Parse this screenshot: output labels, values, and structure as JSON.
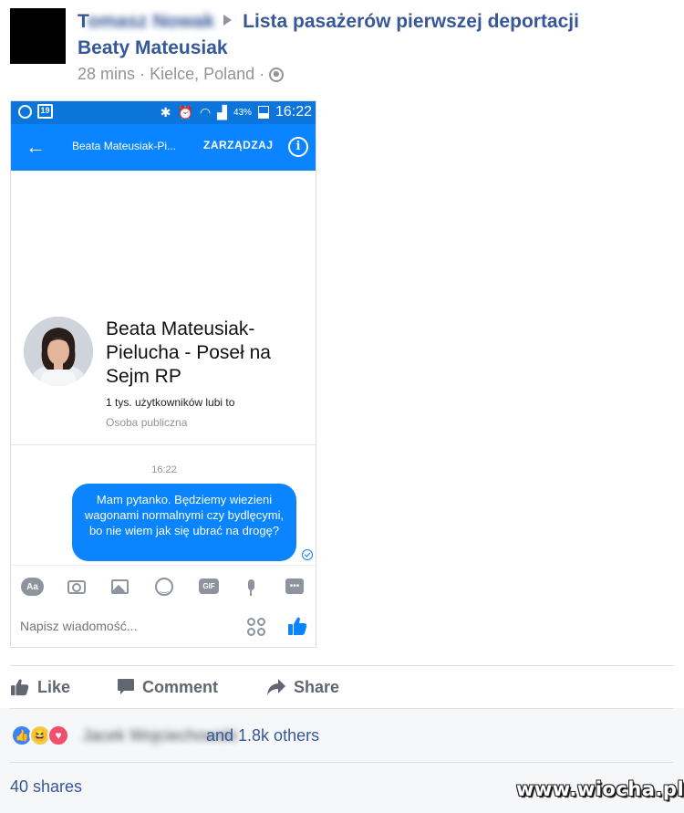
{
  "post": {
    "author_visible": "T",
    "author_blurred": "omasz Nowak",
    "group_title": "Lista pasażerów pierwszej deportacji",
    "group_title_line2": "Beaty Mateusiak",
    "time": "28 mins",
    "location": "Kielce, Poland",
    "separator": "·",
    "privacy_icon": "globe-icon"
  },
  "phone": {
    "status_bar": {
      "calendar_day": "19",
      "battery": "43%",
      "time": "16:22",
      "background": "#0c75db"
    },
    "app_bar": {
      "back_icon": "back-arrow-icon",
      "title": "Beata Mateusiak-Pi...",
      "manage_label": "ZARZĄDZAJ",
      "info_icon": "info-icon",
      "background": "#0a84ff"
    },
    "profile": {
      "name": "Beata Mateusiak-Pielucha - Poseł na Sejm RP",
      "likes": "1 tys. użytkowników lubi to",
      "type": "Osoba publiczna"
    },
    "conversation": {
      "timestamp": "16:22",
      "message": "Mam pytanko. Będziemy wiezieni wagonami normalnymi czy bydlęcymi, bo nie wiem jak się ubrać na drogę?"
    },
    "composer": {
      "aa_label": "Aa",
      "gif_label": "GIF",
      "placeholder": "Napisz wiadomość...",
      "accent": "#0a84ff"
    }
  },
  "actions": {
    "like": "Like",
    "comment": "Comment",
    "share": "Share"
  },
  "reactions": {
    "friend_blurred": "Jacek Wojciechowski",
    "summary": "and 1.8k others",
    "shares": "40 shares"
  },
  "watermark": "www.wiocha.pl",
  "colors": {
    "link_blue": "#365899",
    "meta_gray": "#90949c"
  }
}
